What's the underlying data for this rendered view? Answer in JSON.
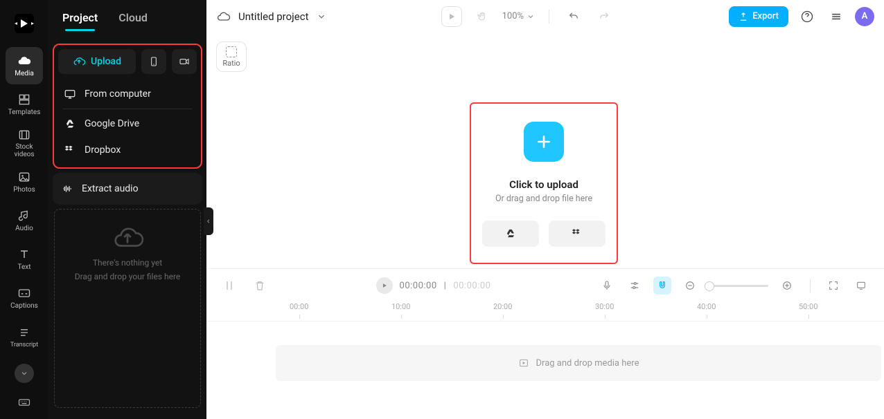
{
  "rail": {
    "items": [
      {
        "label": "Media"
      },
      {
        "label": "Templates"
      },
      {
        "label": "Stock videos"
      },
      {
        "label": "Photos"
      },
      {
        "label": "Audio"
      },
      {
        "label": "Text"
      },
      {
        "label": "Captions"
      },
      {
        "label": "Transcript"
      }
    ]
  },
  "panel": {
    "tabs": {
      "project": "Project",
      "cloud": "Cloud"
    },
    "upload_label": "Upload",
    "menu": {
      "from_computer": "From computer",
      "google_drive": "Google Drive",
      "dropbox": "Dropbox"
    },
    "extract": "Extract audio",
    "dropzone_line1": "There's nothing yet",
    "dropzone_line2": "Drag and drop your files here"
  },
  "topbar": {
    "title": "Untitled project",
    "zoom": "100%",
    "export": "Export",
    "avatar": "A"
  },
  "canvas": {
    "ratio": "Ratio",
    "upload_title": "Click to upload",
    "upload_sub": "Or drag and drop file here"
  },
  "timeline": {
    "current": "00:00:00",
    "sep": "|",
    "total": "00:00:00",
    "ticks": [
      "00:00",
      "10:00",
      "20:00",
      "30:00",
      "40:00",
      "50:00"
    ],
    "placeholder": "Drag and drop media here"
  }
}
